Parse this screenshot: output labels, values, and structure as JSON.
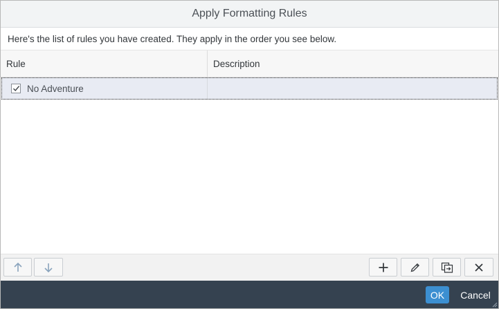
{
  "dialog": {
    "title": "Apply Formatting Rules",
    "intro": "Here's the list of rules you have created. They apply in the order you see below."
  },
  "table": {
    "columns": [
      "Rule",
      "Description"
    ],
    "rows": [
      {
        "checked": true,
        "rule": "No Adventure",
        "description": ""
      }
    ]
  },
  "toolbar": {
    "move_up_icon": "arrow-up-icon",
    "move_down_icon": "arrow-down-icon",
    "add_icon": "plus-icon",
    "edit_icon": "pencil-icon",
    "copy_icon": "duplicate-icon",
    "delete_icon": "close-icon"
  },
  "footer": {
    "ok_label": "OK",
    "cancel_label": "Cancel"
  },
  "colors": {
    "footer_bg": "#354250",
    "ok_bg": "#3c8fd1",
    "selected_row_bg": "#e8ebf3"
  }
}
